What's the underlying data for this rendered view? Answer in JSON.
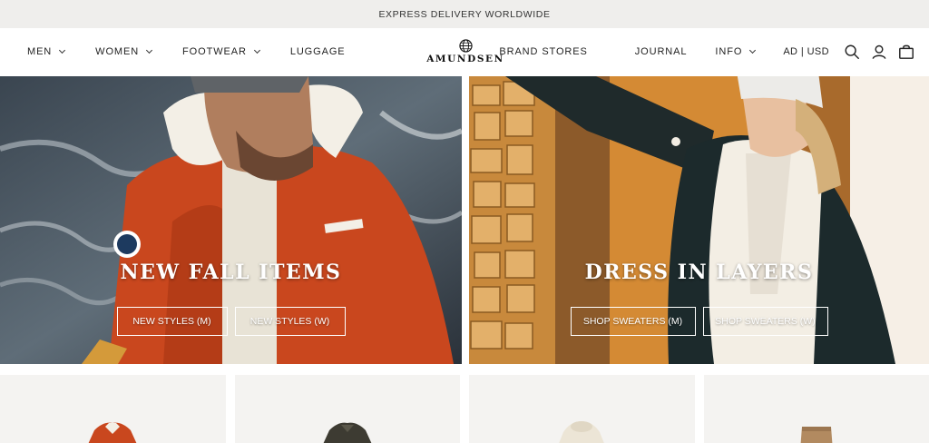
{
  "announcement": {
    "text": "EXPRESS DELIVERY WORLDWIDE"
  },
  "header": {
    "nav_left": [
      {
        "label": "MEN",
        "has_dropdown": true
      },
      {
        "label": "WOMEN",
        "has_dropdown": true
      },
      {
        "label": "FOOTWEAR",
        "has_dropdown": true
      },
      {
        "label": "LUGGAGE",
        "has_dropdown": false
      }
    ],
    "logo": {
      "text": "AMUNDSEN",
      "icon": "globe-icon"
    },
    "nav_right": [
      {
        "label": "BRAND STORES",
        "has_dropdown": false
      },
      {
        "label": "JOURNAL",
        "has_dropdown": false
      },
      {
        "label": "INFO",
        "has_dropdown": true
      }
    ],
    "locale": "AD | USD",
    "icons": [
      "search-icon",
      "account-icon",
      "bag-icon"
    ]
  },
  "heroes": [
    {
      "title": "NEW FALL ITEMS",
      "buttons": [
        "NEW STYLES (M)",
        "NEW STYLES (W)"
      ]
    },
    {
      "title": "DRESS IN LAYERS",
      "buttons": [
        "SHOP SWEATERS (M)",
        "SHOP SWEATERS (W)"
      ]
    }
  ],
  "colors": {
    "announcement_bg": "#efeeec",
    "jacket_orange": "#c9471e",
    "wood": "#c8893c",
    "product_bg": "#f4f3f1"
  }
}
